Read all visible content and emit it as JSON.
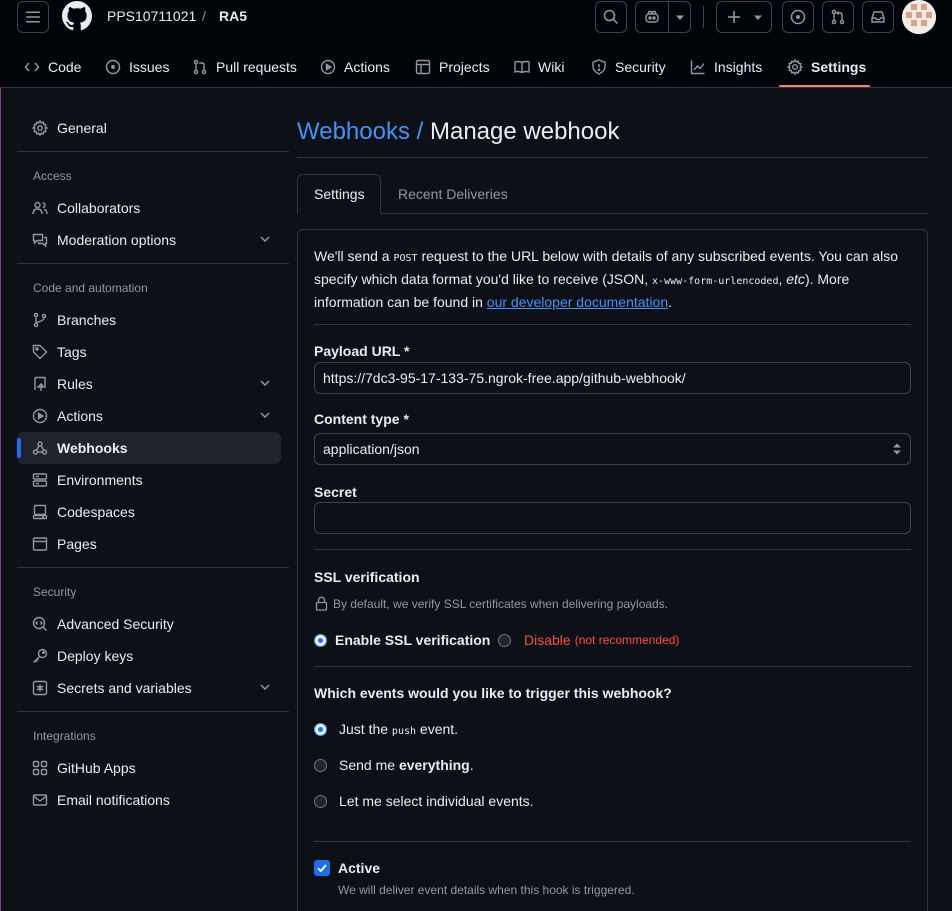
{
  "header": {
    "owner": "PPS10711021",
    "separator": "/",
    "repo": "RA5"
  },
  "tabs": [
    {
      "label": "Code",
      "icon": "code-icon"
    },
    {
      "label": "Issues",
      "icon": "issue-opened-icon"
    },
    {
      "label": "Pull requests",
      "icon": "git-pull-request-icon"
    },
    {
      "label": "Actions",
      "icon": "play-icon"
    },
    {
      "label": "Projects",
      "icon": "table-icon"
    },
    {
      "label": "Wiki",
      "icon": "book-icon"
    },
    {
      "label": "Security",
      "icon": "shield-icon"
    },
    {
      "label": "Insights",
      "icon": "graph-icon"
    },
    {
      "label": "Settings",
      "icon": "gear-icon",
      "active": true
    }
  ],
  "sidebar": {
    "general": "General",
    "access_heading": "Access",
    "collaborators": "Collaborators",
    "moderation": "Moderation options",
    "code_heading": "Code and automation",
    "branches": "Branches",
    "tags": "Tags",
    "rules": "Rules",
    "actions": "Actions",
    "webhooks": "Webhooks",
    "environments": "Environments",
    "codespaces": "Codespaces",
    "pages": "Pages",
    "security_heading": "Security",
    "advanced_security": "Advanced Security",
    "deploy_keys": "Deploy keys",
    "secrets": "Secrets and variables",
    "integrations_heading": "Integrations",
    "github_apps": "GitHub Apps",
    "email_notifications": "Email notifications"
  },
  "main": {
    "breadcrumb_link": "Webhooks",
    "breadcrumb_sep": " / ",
    "title": "Manage webhook",
    "tab_settings": "Settings",
    "tab_recent": "Recent Deliveries",
    "intro_1": "We'll send a ",
    "intro_post": "POST",
    "intro_2": " request to the URL below with details of any subscribed events. You can also specify which data format you'd like to receive (JSON, ",
    "intro_form": "x-www-form-urlencoded",
    "intro_3": ", ",
    "intro_etc": "etc",
    "intro_4": "). More information can be found in ",
    "intro_link": "our developer documentation",
    "intro_5": ".",
    "payload_label": "Payload URL *",
    "payload_value": "https://7dc3-95-17-133-75.ngrok-free.app/github-webhook/",
    "content_label": "Content type *",
    "content_value": "application/json",
    "secret_label": "Secret",
    "secret_value": "",
    "ssl_label": "SSL verification",
    "ssl_note": "By default, we verify SSL certificates when delivering payloads.",
    "ssl_enable": "Enable SSL verification",
    "ssl_disable": "Disable",
    "ssl_disable_note": "(not recommended)",
    "events_label": "Which events would you like to trigger this webhook?",
    "event_push_1": "Just the ",
    "event_push_code": "push",
    "event_push_2": " event.",
    "event_all_1": "Send me ",
    "event_all_bold": "everything",
    "event_all_2": ".",
    "event_select": "Let me select individual events.",
    "active_label": "Active",
    "active_note": "We will deliver event details when this hook is triggered."
  },
  "colors": {
    "accent": "#4493f8",
    "tab_underline": "#f78166",
    "danger": "#f85149",
    "background": "#0d1117"
  }
}
